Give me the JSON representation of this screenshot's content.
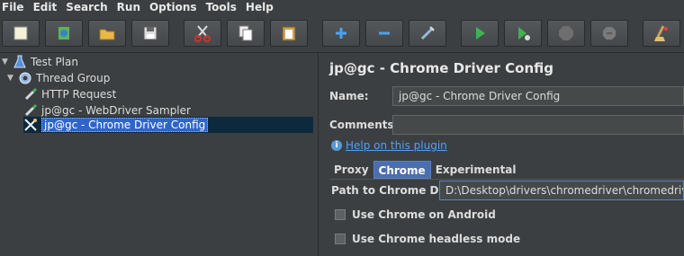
{
  "menu": [
    {
      "label": "File"
    },
    {
      "label": "Edit"
    },
    {
      "label": "Search"
    },
    {
      "label": "Run"
    },
    {
      "label": "Options"
    },
    {
      "label": "Tools"
    },
    {
      "label": "Help"
    }
  ],
  "toolbar": [
    {
      "icon": "new-icon"
    },
    {
      "icon": "templates-icon"
    },
    {
      "icon": "open-icon"
    },
    {
      "icon": "save-icon"
    },
    {
      "icon": "cut-icon"
    },
    {
      "icon": "copy-icon"
    },
    {
      "icon": "paste-icon"
    },
    {
      "icon": "expand-icon"
    },
    {
      "icon": "collapse-icon"
    },
    {
      "icon": "toggle-icon"
    },
    {
      "icon": "start-icon"
    },
    {
      "icon": "start-no-pauses-icon"
    },
    {
      "icon": "stop-icon"
    },
    {
      "icon": "shutdown-icon"
    },
    {
      "icon": "clear-icon"
    }
  ],
  "tree": [
    {
      "label": "Test Plan",
      "icon": "flask-icon"
    },
    {
      "label": "Thread Group",
      "icon": "gear-icon"
    },
    {
      "label": "HTTP Request",
      "icon": "pipette-icon"
    },
    {
      "label": "jp@gc - WebDriver Sampler",
      "icon": "pipette-icon"
    },
    {
      "label": "jp@gc - Chrome Driver Config",
      "icon": "wrench-icon"
    }
  ],
  "panel": {
    "title": "jp@gc - Chrome Driver Config",
    "name_label": "Name:",
    "name_value": "jp@gc - Chrome Driver Config",
    "comments_label": "Comments:",
    "comments_value": "",
    "help_link": "Help on this plugin",
    "tabs": [
      {
        "label": "Proxy"
      },
      {
        "label": "Chrome"
      },
      {
        "label": "Experimental"
      }
    ],
    "active_tab": "Chrome",
    "path_label": "Path to Chrome Driver",
    "path_value": "D:\\Desktop\\drivers\\chromedriver\\chromedriver.exe",
    "android_label": "Use Chrome on Android",
    "headless_label": "Use Chrome headless mode"
  }
}
